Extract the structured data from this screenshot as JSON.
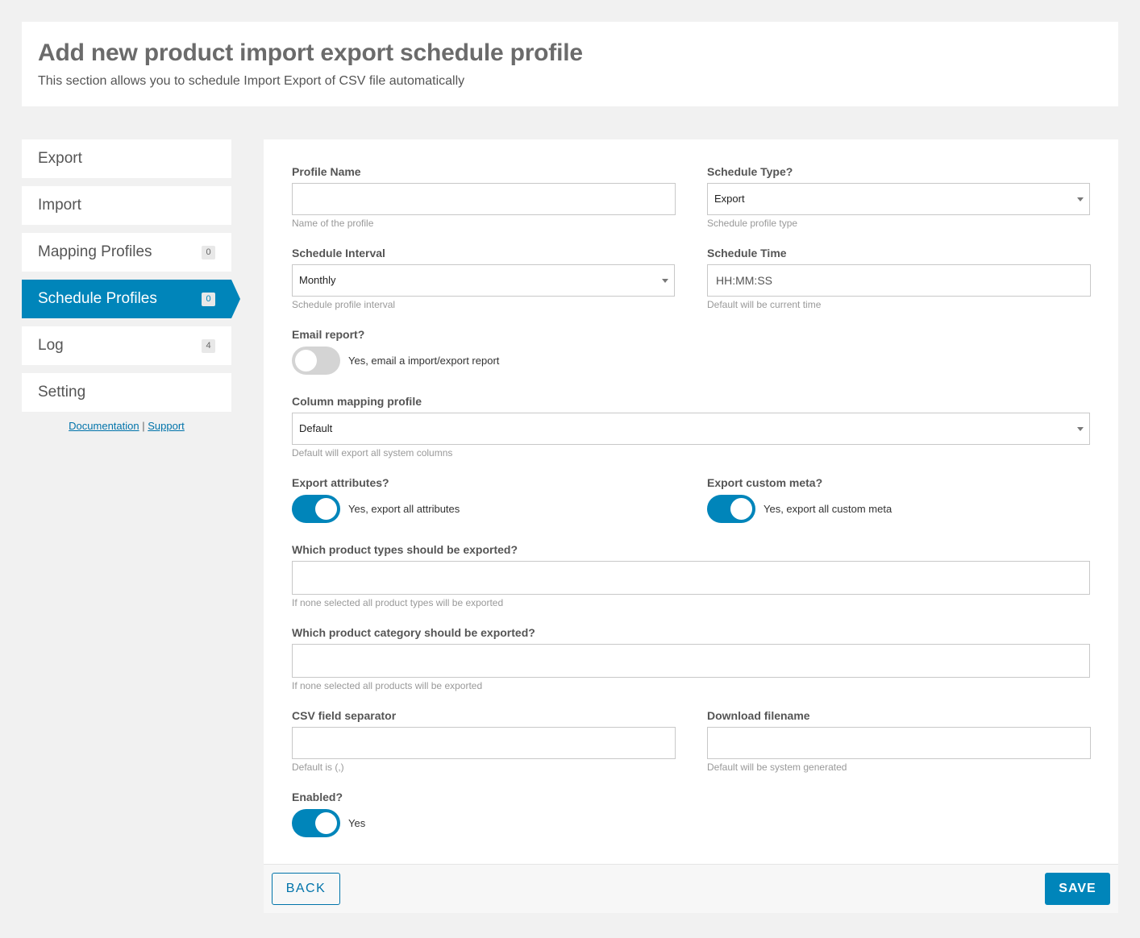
{
  "header": {
    "title": "Add new product import export schedule profile",
    "subtitle": "This section allows you to schedule Import Export of CSV file automatically"
  },
  "sidebar": {
    "items": [
      {
        "label": "Export",
        "badge": null,
        "active": false
      },
      {
        "label": "Import",
        "badge": null,
        "active": false
      },
      {
        "label": "Mapping Profiles",
        "badge": "0",
        "active": false
      },
      {
        "label": "Schedule Profiles",
        "badge": "0",
        "active": true
      },
      {
        "label": "Log",
        "badge": "4",
        "active": false
      },
      {
        "label": "Setting",
        "badge": null,
        "active": false
      }
    ],
    "links": {
      "documentation": "Documentation",
      "separator": "|",
      "support": "Support"
    }
  },
  "form": {
    "profile_name": {
      "label": "Profile Name",
      "value": "",
      "help": "Name of the profile"
    },
    "schedule_type": {
      "label": "Schedule Type?",
      "selected": "Export",
      "help": "Schedule profile type"
    },
    "schedule_interval": {
      "label": "Schedule Interval",
      "selected": "Monthly",
      "help": "Schedule profile interval"
    },
    "schedule_time": {
      "label": "Schedule Time",
      "placeholder": "HH:MM:SS",
      "help": "Default will be current time"
    },
    "email_report": {
      "label": "Email report?",
      "toggle_text": "Yes, email a import/export report",
      "enabled": false
    },
    "column_mapping": {
      "label": "Column mapping profile",
      "selected": "Default",
      "help": "Default will export all system columns"
    },
    "export_attributes": {
      "label": "Export attributes?",
      "toggle_text": "Yes, export all attributes",
      "enabled": true
    },
    "export_custom_meta": {
      "label": "Export custom meta?",
      "toggle_text": "Yes, export all custom meta",
      "enabled": true
    },
    "product_types": {
      "label": "Which product types should be exported?",
      "value": "",
      "help": "If none selected all product types will be exported"
    },
    "product_category": {
      "label": "Which product category should be exported?",
      "value": "",
      "help": "If none selected all products will be exported"
    },
    "csv_separator": {
      "label": "CSV field separator",
      "value": "",
      "help": "Default is (,)"
    },
    "download_filename": {
      "label": "Download filename",
      "value": "",
      "help": "Default will be system generated"
    },
    "enabled": {
      "label": "Enabled?",
      "toggle_text": "Yes",
      "enabled": true
    }
  },
  "footer": {
    "back_label": "BACK",
    "save_label": "SAVE"
  },
  "colors": {
    "accent": "#0085ba",
    "link": "#0073aa",
    "background": "#f1f1f1",
    "toggle_off": "#d4d4d4"
  }
}
